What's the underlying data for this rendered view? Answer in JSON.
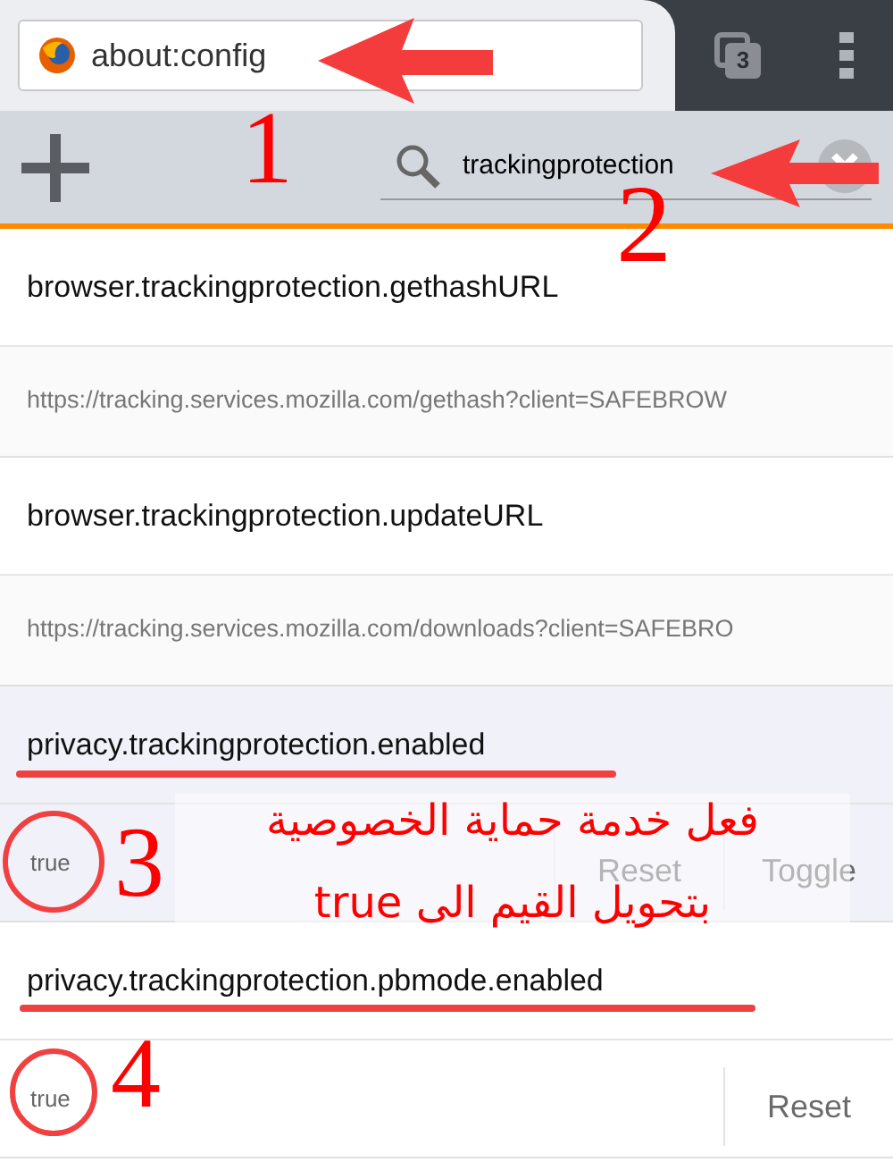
{
  "address_bar": {
    "url": "about:config"
  },
  "tabs_button": {
    "count": "3"
  },
  "search": {
    "value": "trackingprotection"
  },
  "preferences": [
    {
      "kind": "collapsed",
      "name": "browser.trackingprotection.gethashURL",
      "value": "https://tracking.services.mozilla.com/gethash?client=SAFEBROW",
      "selected": false
    },
    {
      "kind": "collapsed",
      "name": "browser.trackingprotection.updateURL",
      "value": "https://tracking.services.mozilla.com/downloads?client=SAFEBRO",
      "selected": false
    },
    {
      "kind": "expanded",
      "name": "privacy.trackingprotection.enabled",
      "value": "true",
      "selected": true,
      "buttons": [
        "Reset",
        "Toggle"
      ]
    },
    {
      "kind": "expanded",
      "name": "privacy.trackingprotection.pbmode.enabled",
      "value": "true",
      "selected": false,
      "buttons": [
        "Reset"
      ]
    }
  ],
  "annotations": {
    "numbers": [
      "1",
      "2",
      "3",
      "4"
    ],
    "caption": [
      "فعل خدمة حماية الخصوصية",
      "بتحويل القيم الى true"
    ]
  }
}
